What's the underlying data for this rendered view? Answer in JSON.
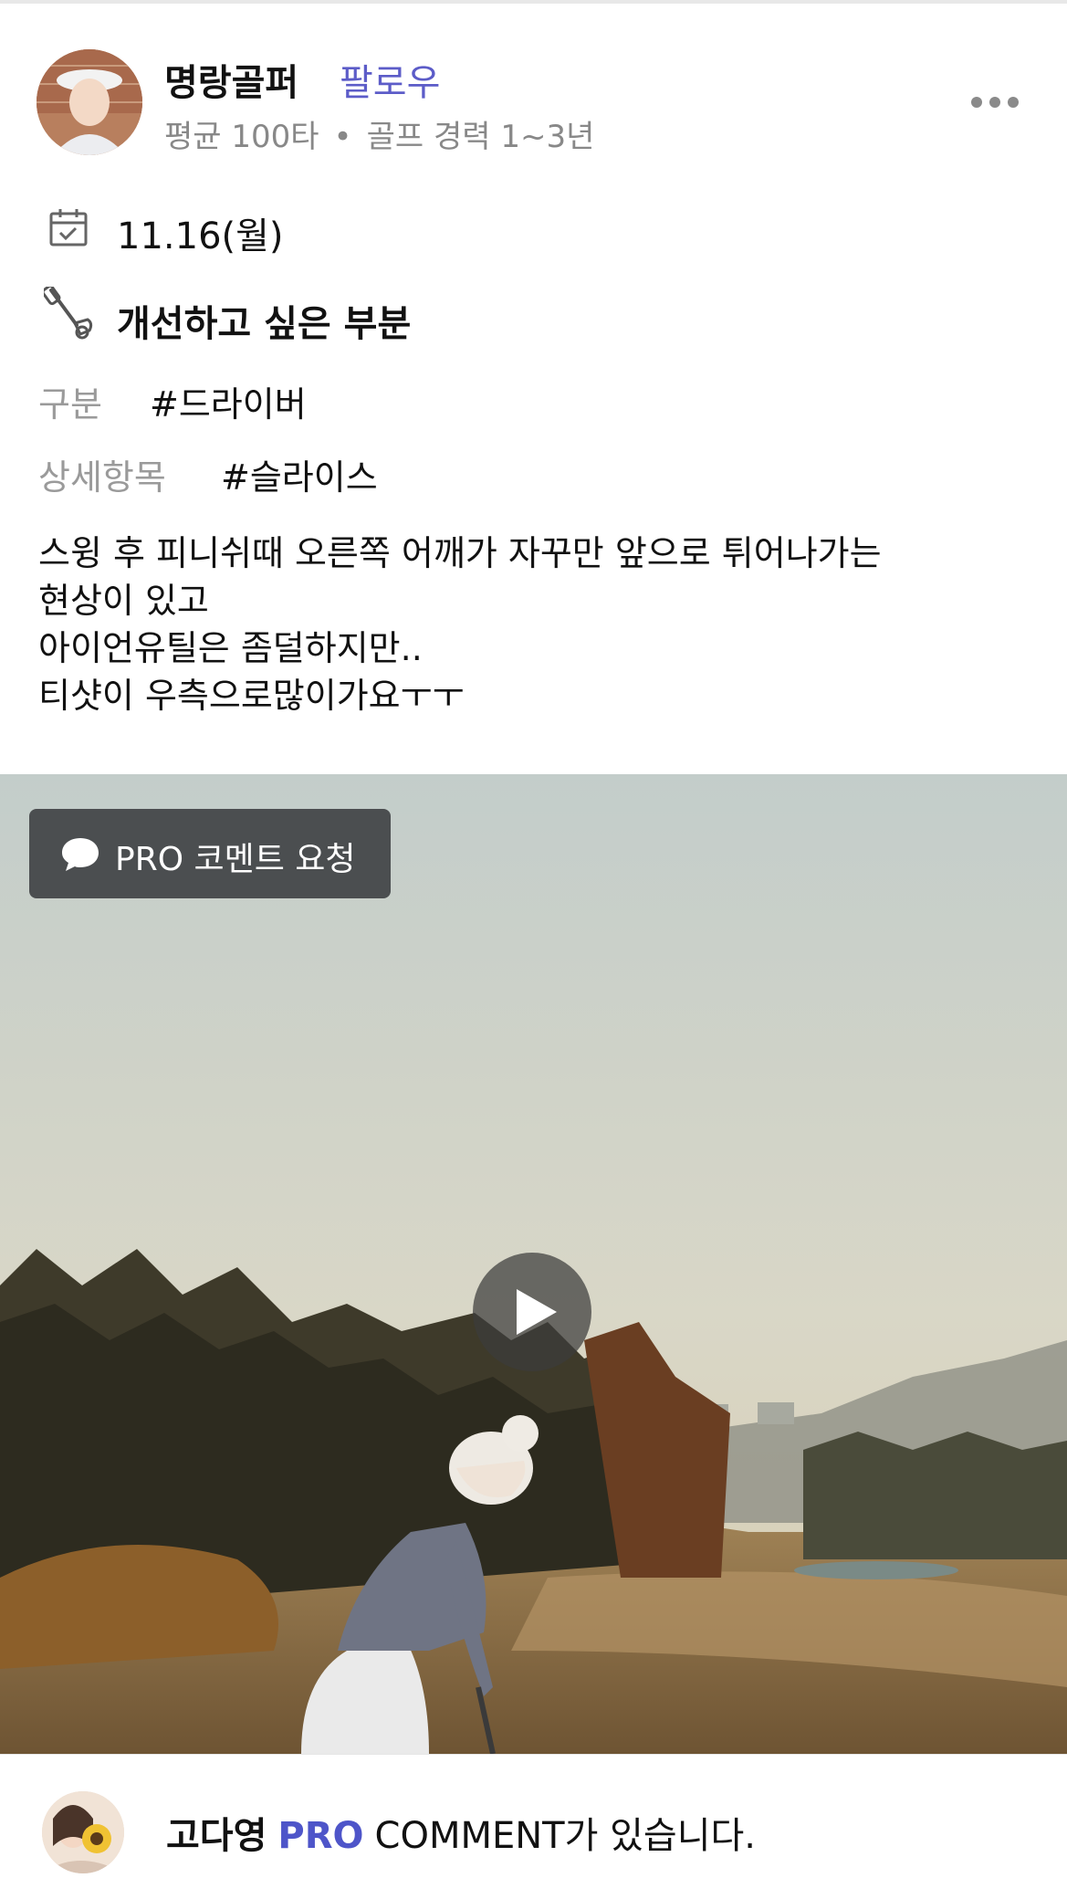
{
  "profile": {
    "name": "명랑골퍼",
    "follow_label": "팔로우",
    "average_score": "평균 100타",
    "separator": "•",
    "golf_experience": "골프 경력 1~3년"
  },
  "post": {
    "date": "11.16(월)",
    "improve_title": "개선하고 싶은 부분",
    "category_label": "구분",
    "category_value": "#드라이버",
    "detail_label": "상세항목",
    "detail_value": "#슬라이스",
    "description_lines": [
      "스윙 후 피니쉬때 오른쪽 어깨가 자꾸만 앞으로 튀어나가는",
      "현상이 있고",
      "아이언유틸은 좀덜하지만..",
      "티샷이 우측으로많이가요ㅜㅜ"
    ]
  },
  "video": {
    "pro_request_label": "PRO 코멘트 요청",
    "play_icon": "play-icon"
  },
  "comment": {
    "pro_name": "고다영",
    "pro_badge": "PRO",
    "message": "COMMENT가 있습니다."
  },
  "colors": {
    "follow": "#5c5cc8",
    "pro_badge": "#4e55c9",
    "muted": "#9a9a9a",
    "button_bg": "#4b4e50"
  }
}
